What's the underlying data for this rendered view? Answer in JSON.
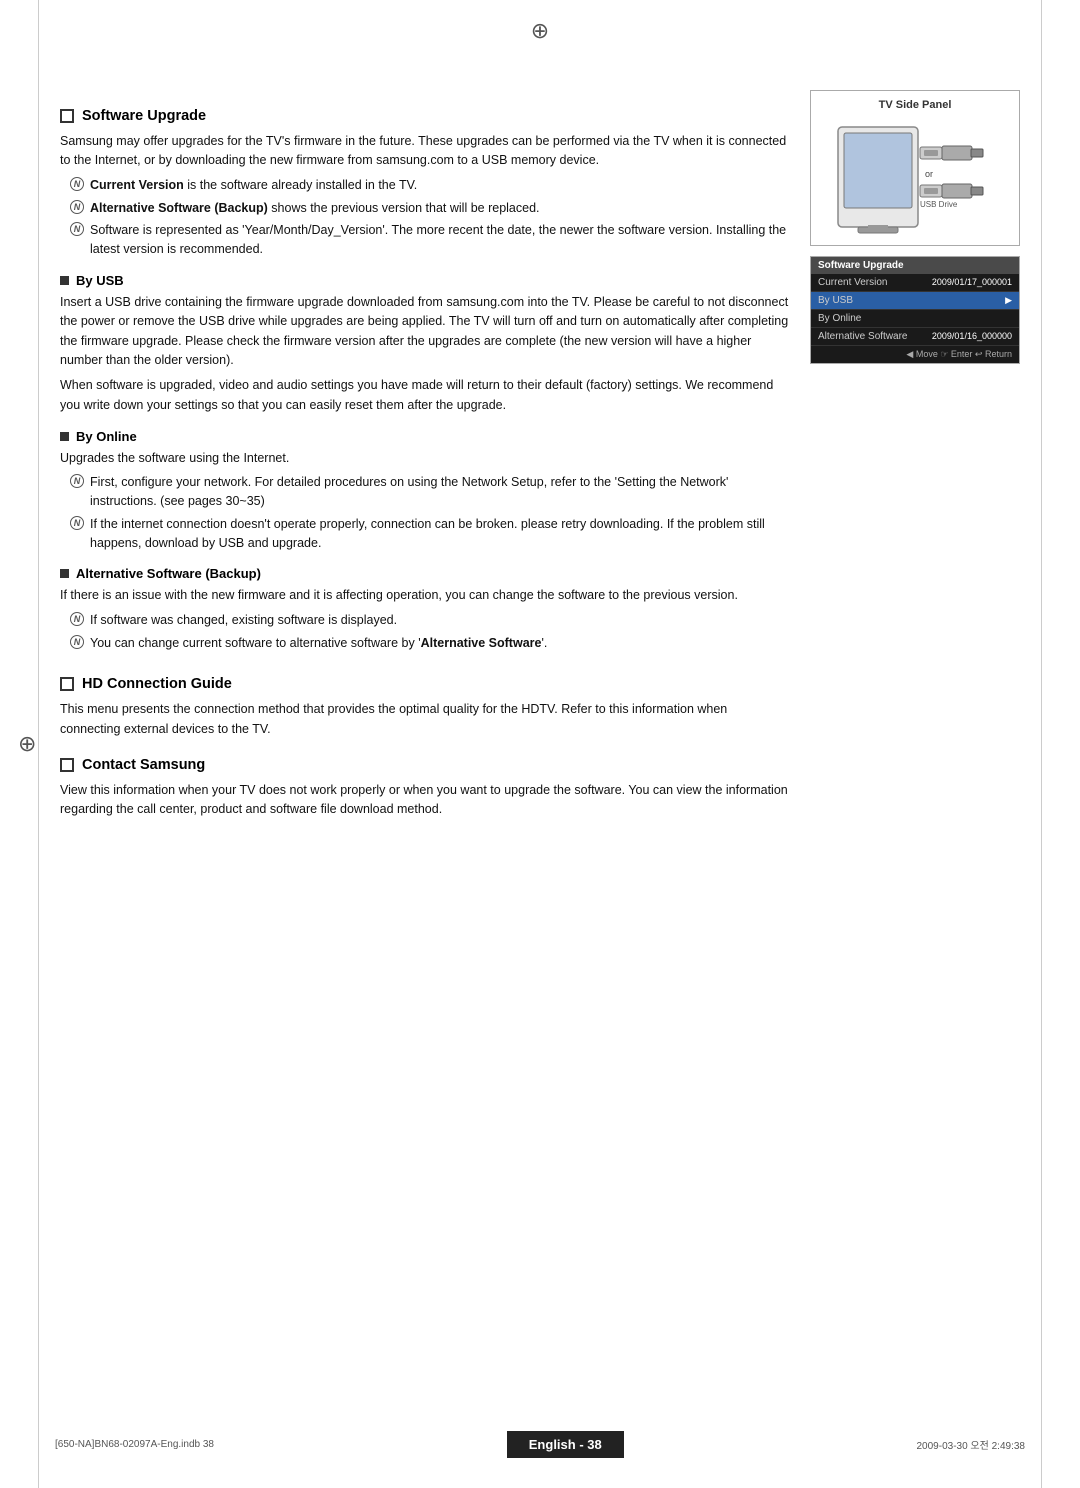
{
  "page": {
    "number_label": "English - 38",
    "footer_left": "[650-NA]BN68-02097A-Eng.indb  38",
    "footer_right": "2009-03-30   오전 2:49:38"
  },
  "software_upgrade": {
    "heading": "Software Upgrade",
    "intro": "Samsung may offer upgrades for the TV's firmware in the future. These upgrades can be performed via the TV when it is connected to the Internet, or by downloading the new firmware from samsung.com to a USB memory device.",
    "notes": [
      {
        "id": "note1",
        "text": "Current Version is the software already installed in the TV.",
        "bold_part": "Current Version"
      },
      {
        "id": "note2",
        "text": "Alternative Software (Backup) shows the previous version that will be replaced.",
        "bold_part": "Alternative Software (Backup)"
      },
      {
        "id": "note3",
        "text": "Software is represented as 'Year/Month/Day_Version'. The more recent the date, the newer the software version. Installing the latest version is recommended."
      }
    ],
    "by_usb": {
      "heading": "By USB",
      "body": "Insert a USB drive containing the firmware upgrade downloaded from samsung.com into the TV. Please be careful to not disconnect the power or remove the USB drive while upgrades are being applied. The TV will turn off and turn on automatically after completing the firmware upgrade. Please check the firmware version after the upgrades are complete (the new version will have a higher number than the older version).",
      "body2": "When software is upgraded, video and audio settings you have made will return to their default (factory) settings. We recommend you write down your settings so that you can easily reset them after the upgrade."
    },
    "by_online": {
      "heading": "By Online",
      "body": "Upgrades the software using the Internet.",
      "notes": [
        {
          "id": "online1",
          "text": "First, configure your network.  For detailed procedures on using the Network Setup, refer to the 'Setting the Network' instructions. (see pages 30~35)"
        },
        {
          "id": "online2",
          "text": "If the internet connection doesn't operate properly, connection can be broken. please retry downloading. If the problem still happens, download by USB and upgrade."
        }
      ]
    },
    "alternative_software": {
      "heading": "Alternative Software (Backup)",
      "body": "If there is an issue with the new firmware and it is affecting operation, you can change the software to the previous version.",
      "notes": [
        {
          "id": "alt1",
          "text": "If software was changed, existing software is displayed."
        },
        {
          "id": "alt2",
          "text": "You can change current software to alternative software by 'Alternative Software'.",
          "bold_part": "Alternative Software"
        }
      ]
    }
  },
  "hd_connection": {
    "heading": "HD Connection Guide",
    "body": "This menu presents the connection method that provides the optimal quality for the HDTV. Refer to this information when connecting external devices to the TV."
  },
  "contact_samsung": {
    "heading": "Contact Samsung",
    "body": "View this information when your TV does not work properly or when you want to upgrade the software. You can view the information regarding the call center, product and software file download method."
  },
  "tv_panel": {
    "title": "TV Side Panel",
    "or_text": "or",
    "usb_drive_label": "USB Drive"
  },
  "sw_menu": {
    "title": "Software Upgrade",
    "rows": [
      {
        "label": "Current Version",
        "value": "2009/01/17_000001"
      },
      {
        "label": "By USB",
        "value": "",
        "highlight": true
      },
      {
        "label": "By Online",
        "value": ""
      },
      {
        "label": "Alternative Software",
        "value": "2009/01/16_000000"
      }
    ],
    "footer": "◀ Move  ☞ Enter  ↩ Return"
  }
}
